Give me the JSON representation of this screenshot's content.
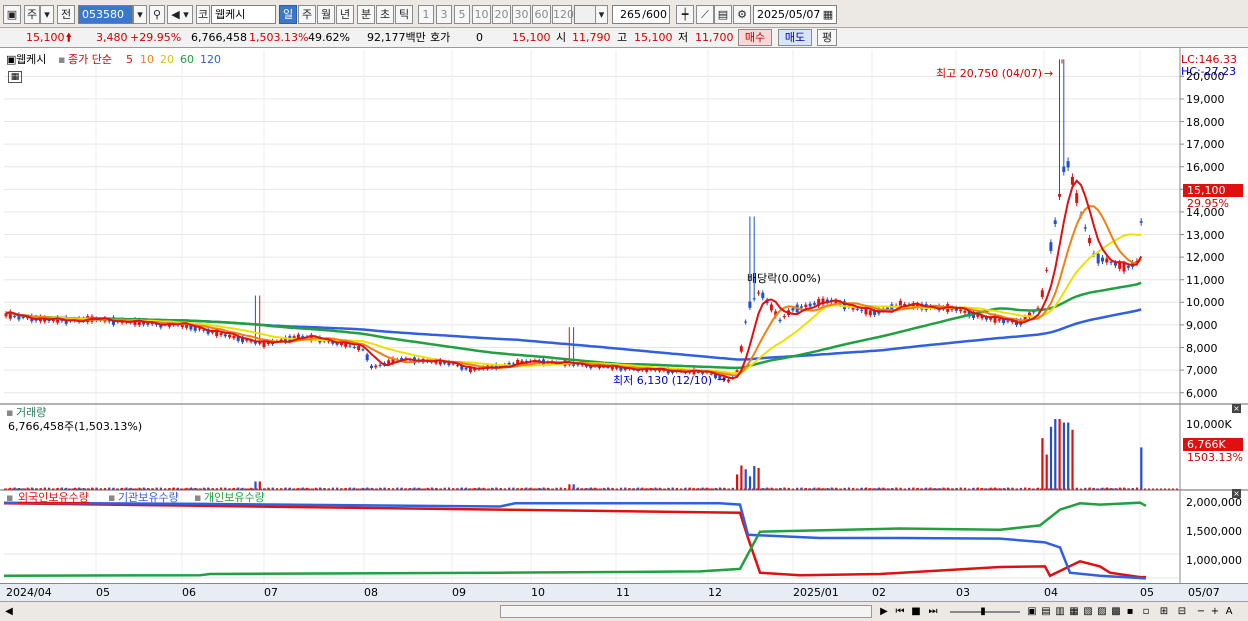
{
  "toolbar": {
    "period_type": "주",
    "compare": "전",
    "code": "053580",
    "market_badge": "코",
    "stock_name": "웹케시",
    "tabs": [
      "일",
      "주",
      "월",
      "년",
      "분",
      "초",
      "틱"
    ],
    "active_tab": "일",
    "intervals": [
      "1",
      "3",
      "5",
      "10",
      "20",
      "30",
      "60",
      "120"
    ],
    "count": "265",
    "count_max": "/600",
    "date": "2025/05/07"
  },
  "quote": {
    "price": "15,100",
    "change": "3,480",
    "change_pct": "+29.95%",
    "volume": "6,766,458",
    "volume_pct": "1,503.13%",
    "turnover_pct": "49.62%",
    "amount": "92,177백만",
    "hoga_label": "호가",
    "hoga_value": "0",
    "hoga_price": "15,100",
    "open_label": "시",
    "open": "11,790",
    "high_label": "고",
    "high": "15,100",
    "low_label": "저",
    "low": "11,700",
    "buy_label": "매수",
    "sell_label": "매도",
    "eval_label": "평"
  },
  "price_panel": {
    "name": "웹케시",
    "legend_prefix": "종가 단순",
    "ma_labels": [
      "5",
      "10",
      "20",
      "60",
      "120"
    ],
    "ma_colors": [
      "#e01010",
      "#f08010",
      "#f0e000",
      "#20a040",
      "#3060e0"
    ],
    "lc": "LC:146.33",
    "hc": "HC:-27.23",
    "y_ticks": [
      "20,000",
      "19,000",
      "18,000",
      "17,000",
      "16,000",
      "15,000",
      "14,000",
      "13,000",
      "12,000",
      "11,000",
      "10,000",
      "9,000",
      "8,000",
      "7,000",
      "6,000"
    ],
    "current_price_tag": "15,100",
    "current_pct_tag": "29.95%",
    "high_annotation": "최고 20,750 (04/07)",
    "low_annotation": "최저 6,130 (12/10)",
    "event_annotation": "배당락(0.00%)"
  },
  "volume_panel": {
    "title": "거래량",
    "value": "6,766,458주(1,503.13%)",
    "y_tick": "10,000K",
    "tag": "6,766K",
    "tag_pct": "1503.13%"
  },
  "holdings_panel": {
    "series": [
      {
        "name": "외국인보유수량",
        "color": "#e01010"
      },
      {
        "name": "기관보유수량",
        "color": "#3060e0"
      },
      {
        "name": "개인보유수량",
        "color": "#20a040"
      }
    ],
    "y_ticks": [
      "2,000,000",
      "1,500,000",
      "1,000,000"
    ]
  },
  "x_axis": [
    "2024/04",
    "05",
    "06",
    "07",
    "08",
    "09",
    "10",
    "11",
    "12",
    "2025/01",
    "02",
    "03",
    "04",
    "05",
    "05/07"
  ],
  "chart_data": {
    "type": "line",
    "title": "웹케시",
    "x": [
      "2024/04",
      "05",
      "06",
      "07",
      "08",
      "09",
      "10",
      "11",
      "12",
      "2025/01",
      "02",
      "03",
      "04",
      "05"
    ],
    "series": [
      {
        "name": "5",
        "values": [
          9400,
          9200,
          9000,
          8200,
          7400,
          7100,
          7400,
          7100,
          6900,
          9500,
          9700,
          9600,
          15200,
          11800
        ]
      },
      {
        "name": "60",
        "values": [
          9300,
          9200,
          9000,
          8500,
          7800,
          7400,
          7300,
          7200,
          7100,
          8200,
          9300,
          9700,
          10000,
          11000
        ]
      },
      {
        "name": "120",
        "values": [
          9800,
          9600,
          9400,
          9200,
          8800,
          8400,
          8000,
          7700,
          7500,
          7700,
          8000,
          8400,
          8900,
          9800
        ]
      }
    ],
    "ylim": [
      6000,
      20750
    ]
  }
}
